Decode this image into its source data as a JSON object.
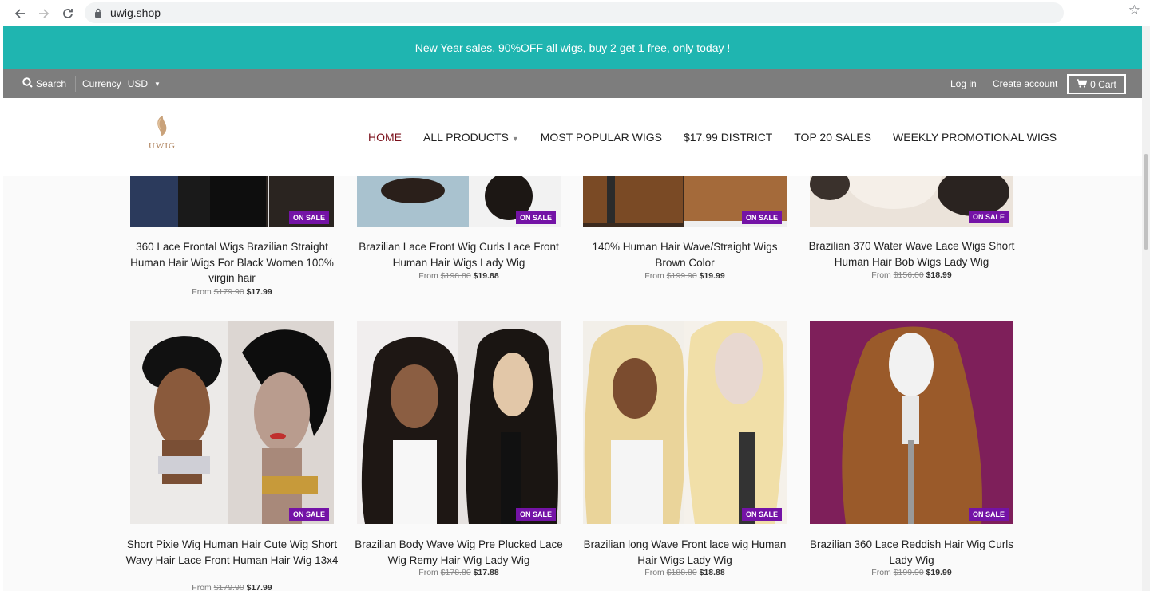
{
  "browser": {
    "url": "uwig.shop"
  },
  "promo": {
    "text": "New Year sales, 90%OFF all wigs, buy 2 get 1 free, only today !"
  },
  "topbar": {
    "search_label": "Search",
    "currency_label": "Currency",
    "currency_value": "USD",
    "login_label": "Log in",
    "create_account_label": "Create account",
    "cart_label": "0 Cart"
  },
  "logo": {
    "text": "UWIG"
  },
  "nav": [
    {
      "label": "HOME"
    },
    {
      "label": "ALL PRODUCTS"
    },
    {
      "label": "MOST POPULAR WIGS"
    },
    {
      "label": "$17.99 DISTRICT"
    },
    {
      "label": "TOP 20 SALES"
    },
    {
      "label": "WEEKLY PROMOTIONAL WIGS"
    }
  ],
  "badge": "ON SALE",
  "price_from": "From",
  "products": [
    {
      "title": "360 Lace Frontal Wigs Brazilian Straight Human Hair Wigs For Black Women 100% virgin hair",
      "old_price": "$179.90",
      "price": "$17.99"
    },
    {
      "title": "Brazilian Lace Front Wig Curls Lace Front Human Hair Wigs Lady Wig",
      "old_price": "$198.80",
      "price": "$19.88"
    },
    {
      "title": "140% Human Hair Wave/Straight Wigs Brown Color",
      "old_price": "$199.90",
      "price": "$19.99"
    },
    {
      "title": "Brazilian 370 Water Wave Lace Wigs Short Human Hair Bob Wigs Lady Wig",
      "old_price": "$156.00",
      "price": "$18.99"
    },
    {
      "title": "Short Pixie Wig Human Hair Cute Wig Short Wavy Hair Lace Front Human Hair Wig 13x4",
      "old_price": "$179.90",
      "price": "$17.99"
    },
    {
      "title": "Brazilian Body Wave Wig Pre Plucked Lace Wig Remy Hair Wig Lady Wig",
      "old_price": "$178.80",
      "price": "$17.88"
    },
    {
      "title": "Brazilian long Wave Front lace wig Human Hair Wigs Lady Wig",
      "old_price": "$188.80",
      "price": "$18.88"
    },
    {
      "title": "Brazilian 360 Lace Reddish Hair Wig Curls Lady Wig",
      "old_price": "$199.90",
      "price": "$19.99"
    }
  ],
  "colors": {
    "promo": "#1fb5b0",
    "topbar": "#7d7d7d",
    "badge": "#7413a6",
    "nav_active": "#7a0e19"
  }
}
